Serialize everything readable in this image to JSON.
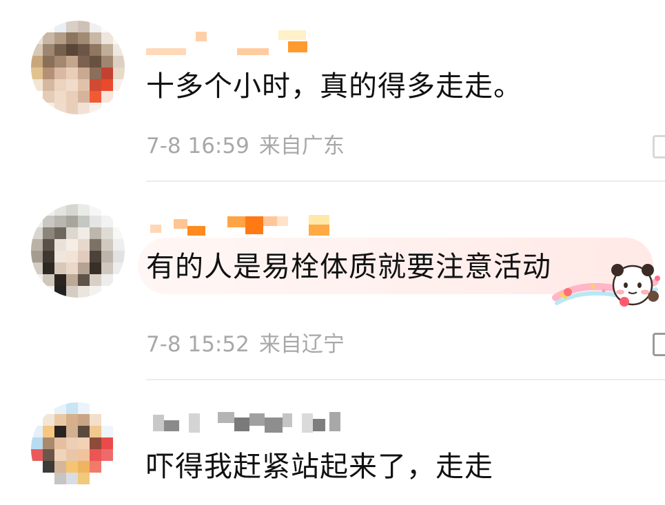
{
  "comments": [
    {
      "content": "十多个小时，真的得多走走。",
      "date": "7-8 16:59",
      "location": "来自广东"
    },
    {
      "content": "有的人是易栓体质就要注意活动",
      "date": "7-8 15:52",
      "location": "来自辽宁"
    },
    {
      "content": "吓得我赶紧站起来了，走走"
    }
  ],
  "colors": {
    "username_orange": "#ff9a2e",
    "username_gray": "#9c9c9c",
    "meta_text": "#a8a8a8",
    "divider": "#ececec",
    "bubble_tint": "#fff0ee"
  },
  "icons": {
    "sticker": "panda-sticker-icon",
    "edge": "edit-icon"
  }
}
